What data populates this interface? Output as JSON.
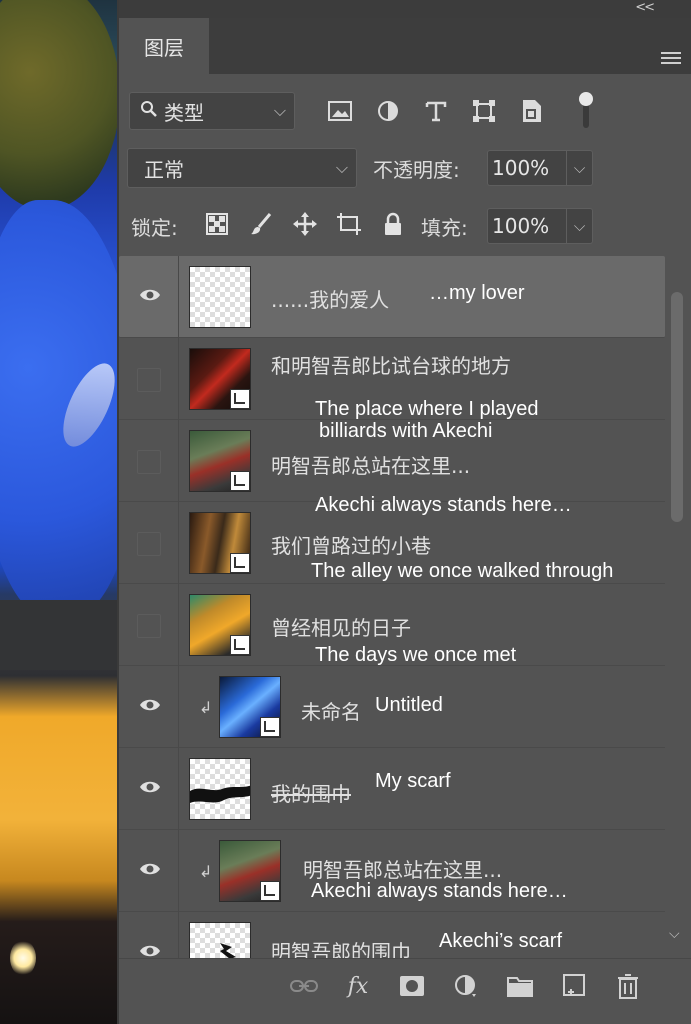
{
  "panel": {
    "collapse_glyph": "<<",
    "tab_label": "图层",
    "colors": {
      "panel_bg": "#535353",
      "tabbar_bg": "#3d3d3d",
      "selected_row": "#6a6a6a"
    }
  },
  "filter": {
    "kind_label": "类型",
    "icons": [
      "image-filter-icon",
      "adjustment-filter-icon",
      "type-filter-icon",
      "shape-filter-icon",
      "smart-object-filter-icon",
      "filter-toggle"
    ]
  },
  "blend": {
    "mode": "正常",
    "opacity_label": "不透明度:",
    "opacity_value": "100%"
  },
  "lock": {
    "label": "锁定:",
    "fill_label": "填充:",
    "fill_value": "100%",
    "icons": [
      "lock-transparent-pixels-icon",
      "lock-image-pixels-icon",
      "lock-position-icon",
      "prevent-autonest-icon",
      "lock-all-icon"
    ]
  },
  "layers": [
    {
      "name": "......我的爱人",
      "translation": "…my lover",
      "visible": true,
      "selected": true,
      "thumb": "checker"
    },
    {
      "name": "和明智吾郎比试台球的地方",
      "translation": "The place where I played billiards with Akechi",
      "translation_line1": "The place where I played",
      "translation_line2": "billiards with Akechi",
      "visible": false,
      "thumb": "photo-red"
    },
    {
      "name": "明智吾郎总站在这里...",
      "translation": "Akechi always stands here…",
      "visible": false,
      "thumb": "photo-street"
    },
    {
      "name": "我们曾路过的小巷",
      "translation": "The alley we once walked through",
      "visible": false,
      "thumb": "photo-alley"
    },
    {
      "name": "曾经相见的日子",
      "translation": "The days we once met",
      "visible": false,
      "thumb": "photo-yellow"
    },
    {
      "name": "未命名",
      "translation": "Untitled",
      "visible": true,
      "clipped": true,
      "thumb": "photo-blue"
    },
    {
      "name": "我的围巾",
      "translation": "My scarf",
      "visible": true,
      "thumb": "scarf"
    },
    {
      "name": "明智吾郎总站在这里...",
      "translation": "Akechi always stands here…",
      "visible": true,
      "clipped": true,
      "thumb": "photo-street"
    },
    {
      "name": "明智吾郎的围巾",
      "translation": "Akechi’s scarf",
      "visible": true,
      "thumb": "scarf-small"
    }
  ],
  "bottom_toolbar": {
    "fx_label": "fx",
    "icons": [
      "link-layers-icon",
      "layer-style-icon",
      "add-mask-icon",
      "new-adjustment-layer-icon",
      "new-group-icon",
      "new-layer-icon",
      "delete-layer-icon"
    ]
  }
}
